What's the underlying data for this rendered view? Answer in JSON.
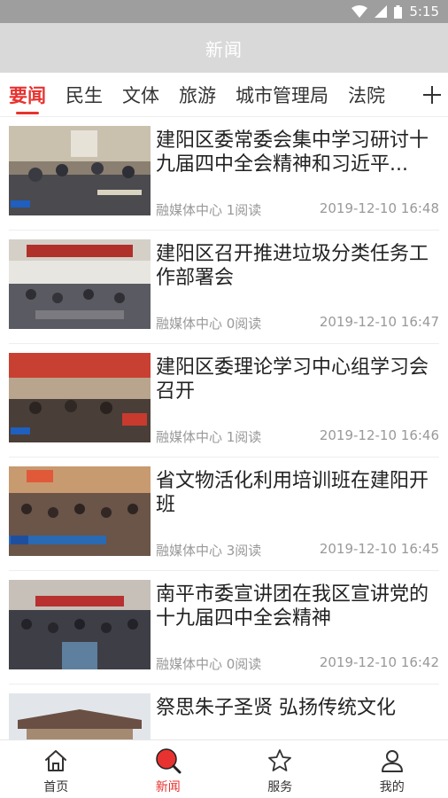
{
  "status_bar": {
    "time": "5:15"
  },
  "header": {
    "title": "新闻"
  },
  "tabs": [
    {
      "label": "要闻",
      "active": true
    },
    {
      "label": "民生"
    },
    {
      "label": "文体"
    },
    {
      "label": "旅游"
    },
    {
      "label": "城市管理局"
    },
    {
      "label": "法院"
    }
  ],
  "news": [
    {
      "title": " 建阳区委常委会集中学习研讨十九届四中全会精神和习近平...",
      "source": "融媒体中心 1阅读",
      "time": "2019-12-10 16:48"
    },
    {
      "title": "建阳区召开推进垃圾分类任务工作部署会",
      "source": "融媒体中心 0阅读",
      "time": "2019-12-10 16:47"
    },
    {
      "title": "建阳区委理论学习中心组学习会召开",
      "source": "融媒体中心 1阅读",
      "time": "2019-12-10 16:46"
    },
    {
      "title": " 省文物活化利用培训班在建阳开班",
      "source": "融媒体中心 3阅读",
      "time": "2019-12-10 16:45"
    },
    {
      "title": "南平市委宣讲团在我区宣讲党的十九届四中全会精神",
      "source": "融媒体中心 0阅读",
      "time": "2019-12-10 16:42"
    },
    {
      "title": "祭思朱子圣贤 弘扬传统文化",
      "source": "",
      "time": ""
    }
  ],
  "bottom_nav": [
    {
      "label": "首页",
      "icon": "home-icon"
    },
    {
      "label": "新闻",
      "icon": "news-icon",
      "active": true
    },
    {
      "label": "服务",
      "icon": "star-icon"
    },
    {
      "label": "我的",
      "icon": "user-icon"
    }
  ],
  "colors": {
    "accent": "#e8322f",
    "header_bg": "#d9d9d9",
    "status_bg": "#9e9e9e"
  }
}
